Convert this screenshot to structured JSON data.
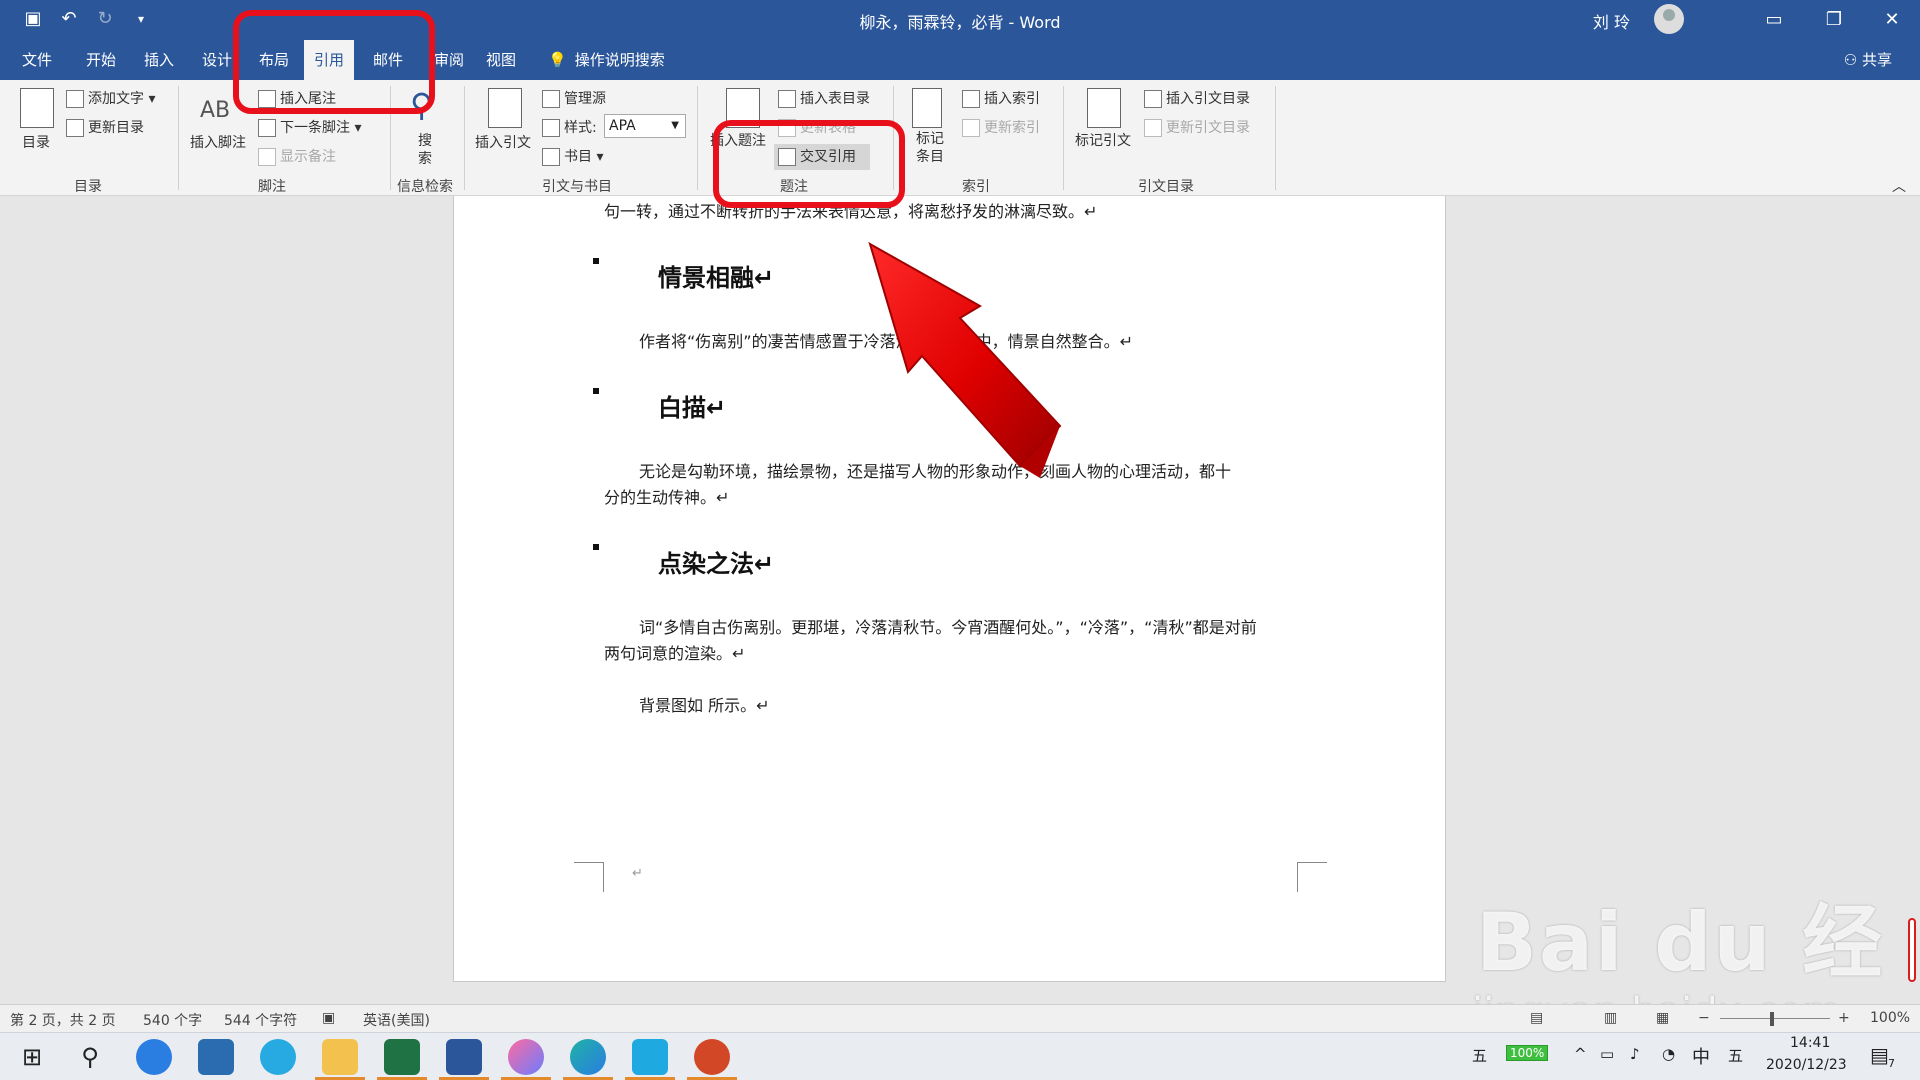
{
  "window": {
    "title": "柳永，雨霖铃，必背 - Word",
    "user": "刘 玲"
  },
  "tabs": [
    "文件",
    "开始",
    "插入",
    "设计",
    "布局",
    "引用",
    "邮件",
    "审阅",
    "视图"
  ],
  "active_tab": "引用",
  "tell_me": "操作说明搜索",
  "share": "共享",
  "ribbon": {
    "toc": {
      "button": "目录",
      "add_text": "添加文字",
      "update": "更新目录",
      "group": "目录"
    },
    "footnotes": {
      "insert_footnote": "插入脚注",
      "insert_endnote": "插入尾注",
      "next_footnote": "下一条脚注",
      "show_notes": "显示备注",
      "group": "脚注"
    },
    "research": {
      "search": "搜索",
      "group": "信息检索"
    },
    "citations": {
      "insert_citation": "插入引文",
      "manage_sources": "管理源",
      "style_label": "样式:",
      "style_value": "APA",
      "bibliography": "书目",
      "group": "引文与书目"
    },
    "captions": {
      "insert_caption": "插入题注",
      "insert_table_of_figures": "插入表目录",
      "update_table": "更新表格",
      "cross_reference": "交叉引用",
      "group": "题注"
    },
    "index": {
      "mark_entry": "标记条目",
      "insert_index": "插入索引",
      "update_index": "更新索引",
      "group": "索引"
    },
    "authorities": {
      "mark_citation": "标记引文",
      "insert_table": "插入引文目录",
      "update_table": "更新引文目录",
      "group": "引文目录"
    }
  },
  "document": {
    "top_line": "句一转，通过不断转折的手法来表情达意，将离愁抒发的淋漓尽致。↵",
    "sections": [
      {
        "heading": "情景相融↵",
        "lines": [
          "作者将“伤离别”的凄苦情感置于冷落清秋的气氛中，情景自然整合。↵"
        ]
      },
      {
        "heading": "白描↵",
        "lines": [
          "无论是勾勒环境，描绘景物，还是描写人物的形象动作，刻画人物的心理活动，都十",
          "分的生动传神。↵"
        ]
      },
      {
        "heading": "点染之法↵",
        "lines": [
          "词“多情自古伤离别。更那堪，冷落清秋节。今宵酒醒何处。”，“冷落”，“清秋”都是对前",
          "两句词意的渲染。↵"
        ]
      }
    ],
    "last_line": "背景图如 所示。↵",
    "footer_mark": "↵"
  },
  "status": {
    "page": "第 2 页，共 2 页",
    "words": "540 个字",
    "chars": "544 个字符",
    "language": "英语(美国)",
    "zoom": "100%"
  },
  "taskbar": {
    "ime1": "五",
    "battery": "100%",
    "ime_lang": "中",
    "ime2": "五",
    "time": "14:41",
    "date": "2020/12/23",
    "notifications": "7"
  },
  "watermark": {
    "logo": "Bai du 经验",
    "url": "jingyan.baidu.com"
  },
  "colors": {
    "word_blue": "#2b579a",
    "annotation_red": "#e8101a"
  }
}
